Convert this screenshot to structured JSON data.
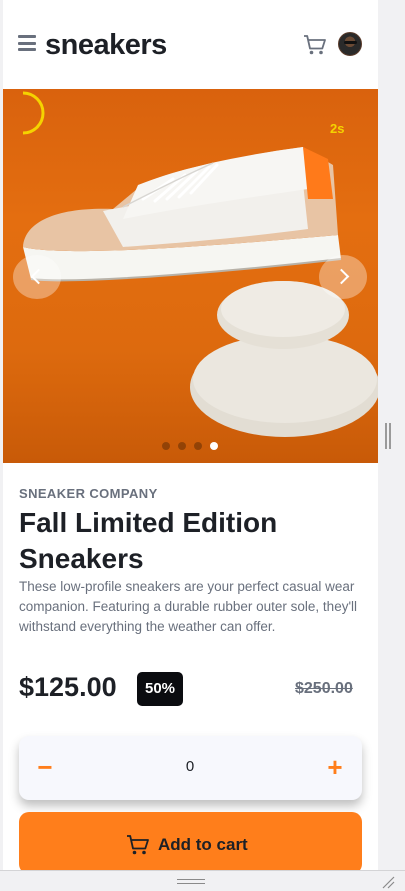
{
  "header": {
    "logo": "sneakers",
    "menu_icon": "hamburger-menu-icon",
    "cart_icon": "cart-icon",
    "avatar": "user-avatar"
  },
  "carousel": {
    "timer_label": "2s",
    "timer_progress": 0.5,
    "prev_icon": "chevron-left-icon",
    "next_icon": "chevron-right-icon",
    "slide_count": 4,
    "active_slide": 4
  },
  "product": {
    "brand": "SNEAKER COMPANY",
    "title": "Fall Limited Edition Sneakers",
    "description": "These low-profile sneakers are your perfect casual wear companion. Featuring a durable rubber outer sole, they'll withstand everything the weather can offer.",
    "price": "$125.00",
    "discount": "50%",
    "old_price": "$250.00"
  },
  "quantity": {
    "minus": "−",
    "value": "0",
    "plus": "+"
  },
  "cta": {
    "label": "Add to cart",
    "icon": "cart-icon"
  },
  "colors": {
    "accent": "#ff7e1b",
    "dark": "#1d2026",
    "muted": "#69707d",
    "timer": "#f5d300"
  }
}
